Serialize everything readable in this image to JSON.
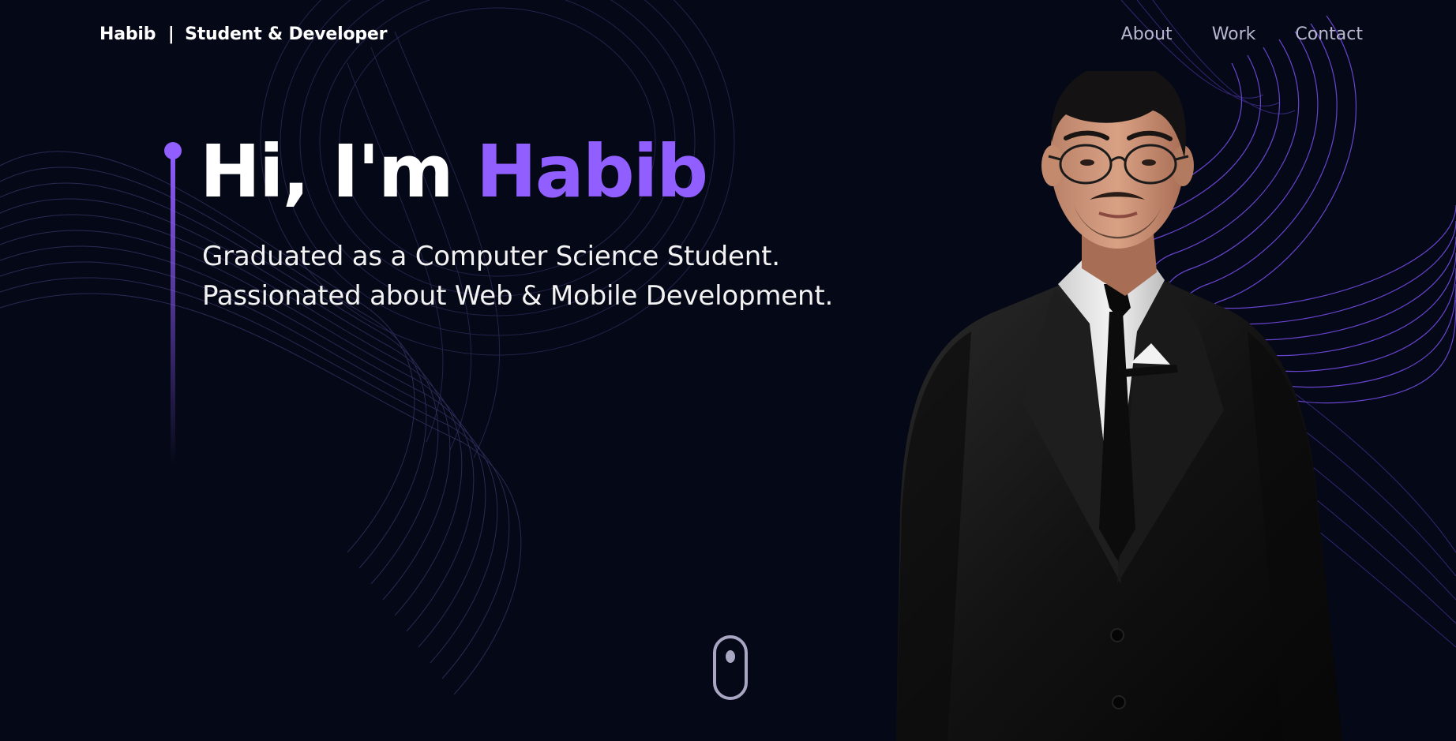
{
  "header": {
    "brand_name": "Habib",
    "brand_separator": "|",
    "brand_tagline": "Student & Developer"
  },
  "nav": {
    "items": [
      {
        "label": "About"
      },
      {
        "label": "Work"
      },
      {
        "label": "Contact"
      }
    ]
  },
  "hero": {
    "greeting": "Hi, I'm",
    "name": "Habib",
    "subtitle_line1": "Graduated as a Computer Science Student.",
    "subtitle_line2": "Passionated about Web & Mobile Development."
  },
  "colors": {
    "background": "#050816",
    "accent": "#915eff",
    "text": "#ffffff",
    "nav_text": "#b9b7cf"
  },
  "icons": {
    "avatar": "3d-avatar-man-in-suit-with-glasses",
    "scroll": "mouse-scroll-icon"
  }
}
